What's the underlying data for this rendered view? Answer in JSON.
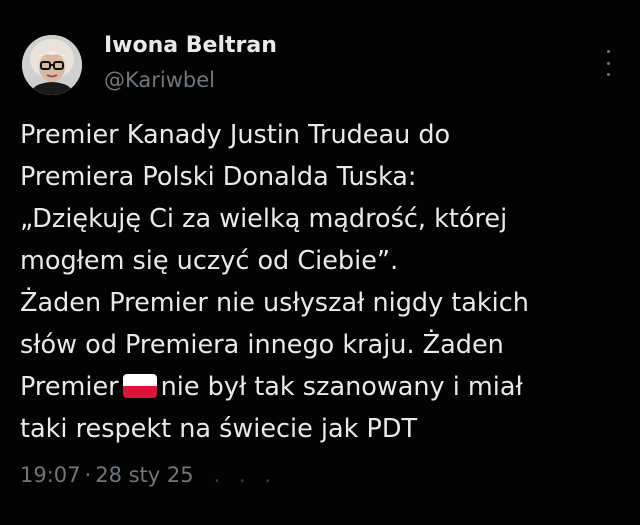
{
  "author": {
    "name": "Iwona Beltran",
    "handle": "@Kariwbel"
  },
  "tweet": {
    "lines": {
      "l1": "Premier Kanady Justin Trudeau do",
      "l2": "Premiera Polski Donalda Tuska:",
      "l3": "„Dziękuję Ci za wielką mądrość, której",
      "l4": "mogłem się uczyć od Ciebie”.",
      "l5": "Żaden Premier nie usłyszał nigdy takich",
      "l6": "słów od Premiera innego kraju. Żaden",
      "l7_before": "Premier",
      "l7_after": "nie był tak szanowany i miał",
      "l8": "taki respekt na świecie jak PDT"
    },
    "emoji": "poland-flag-icon"
  },
  "meta": {
    "time": "19:07",
    "separator": "·",
    "date": "28 sty 25"
  },
  "colors": {
    "background": "#030303",
    "text": "#e7e9ea",
    "secondary": "#71767b",
    "flag_white": "#ffffff",
    "flag_red": "#dc143c"
  }
}
